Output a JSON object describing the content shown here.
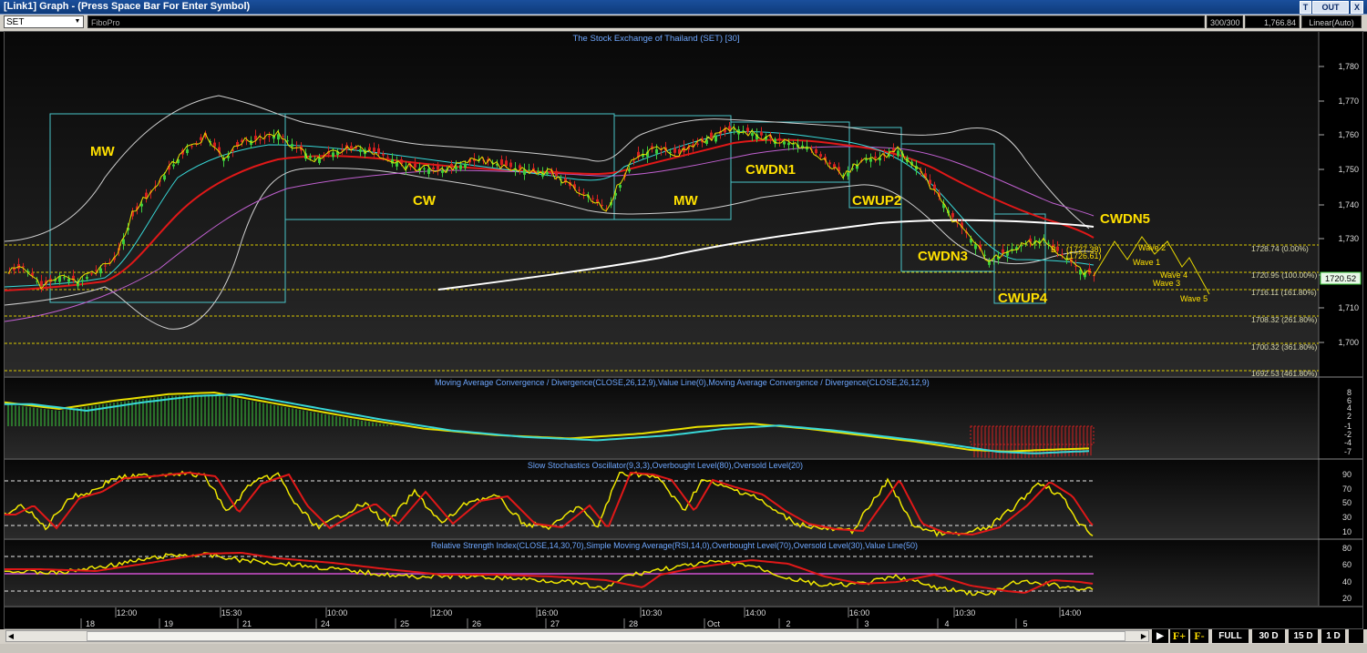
{
  "window": {
    "title": "[Link1] Graph  - (Press Space Bar For Enter Symbol)",
    "btn_t": "T",
    "btn_out": "OUT",
    "btn_close": "X"
  },
  "toolbar": {
    "symbol": "SET",
    "tool_name": "FiboPro",
    "bars": "300/300",
    "price": "1,766.84",
    "scale": "Linear(Auto)"
  },
  "price_panel": {
    "title": "The Stock Exchange of Thailand (SET) [30]",
    "y_ticks": [
      "1,780",
      "1,770",
      "1,760",
      "1,750",
      "1,740",
      "1,730",
      "1,720",
      "1,710",
      "1,700"
    ],
    "fib_levels": [
      "1728.74 (0.00%)",
      "1720.95 (100.00%)",
      "1716.11 (161.80%)",
      "1708.32 (261.80%)",
      "1700.32 (361.80%)",
      "1692.53 (461.80%)"
    ],
    "last_price": "1720.52",
    "pattern_labels": [
      "MW",
      "CW",
      "MW",
      "CWDN1",
      "CWUP2",
      "CWDN3",
      "CWUP4",
      "CWDN5"
    ],
    "wave_labels": [
      "Wave 2",
      "Wave 1",
      "Wave 4",
      "Wave 3",
      "Wave 5"
    ],
    "fib_small": [
      "(1727.38)",
      "(1726.61)",
      "B"
    ],
    "colors": {
      "bb": "#cfcfcf",
      "ma_red": "#e01818",
      "ma_cyan": "#38d8d8",
      "ma_violet": "#c060d0",
      "ma_white": "#ffffff",
      "label": "#ffe000",
      "box": "#49c4c8",
      "fib": "#d8c800"
    }
  },
  "macd_panel": {
    "title": "Moving Average Convergence / Divergence(CLOSE,26,12,9),Value Line(0),Moving Average Convergence / Divergence(CLOSE,26,12,9)",
    "y_ticks": [
      "8",
      "6",
      "4",
      "2",
      "-1",
      "-2",
      "-4",
      "-7"
    ]
  },
  "stoch_panel": {
    "title": "Slow Stochastics Oscillator(9,3,3),Overbought Level(80),Oversold Level(20)",
    "y_ticks": [
      "90",
      "70",
      "50",
      "30",
      "10"
    ]
  },
  "rsi_panel": {
    "title": "Relative Strength Index(CLOSE,14,30,70),Simple Moving Average(RSI,14,0),Overbought Level(70),Oversold Level(30),Value Line(50)",
    "y_ticks": [
      "80",
      "60",
      "40",
      "20"
    ]
  },
  "x_axis": {
    "times": [
      "12:00",
      "15:30",
      "10:00",
      "12:00",
      "16:00",
      "10:30",
      "14:00",
      "16:00",
      "10:30",
      "14:00"
    ],
    "dates": [
      "18",
      "19",
      "21",
      "24",
      "25",
      "26",
      "27",
      "28",
      "Oct",
      "2",
      "3",
      "4",
      "5"
    ]
  },
  "bottom": {
    "f_plus": "F+",
    "f_minus": "F-",
    "full": "FULL",
    "d30": "30 D",
    "d15": "15 D",
    "d1": "1 D"
  }
}
